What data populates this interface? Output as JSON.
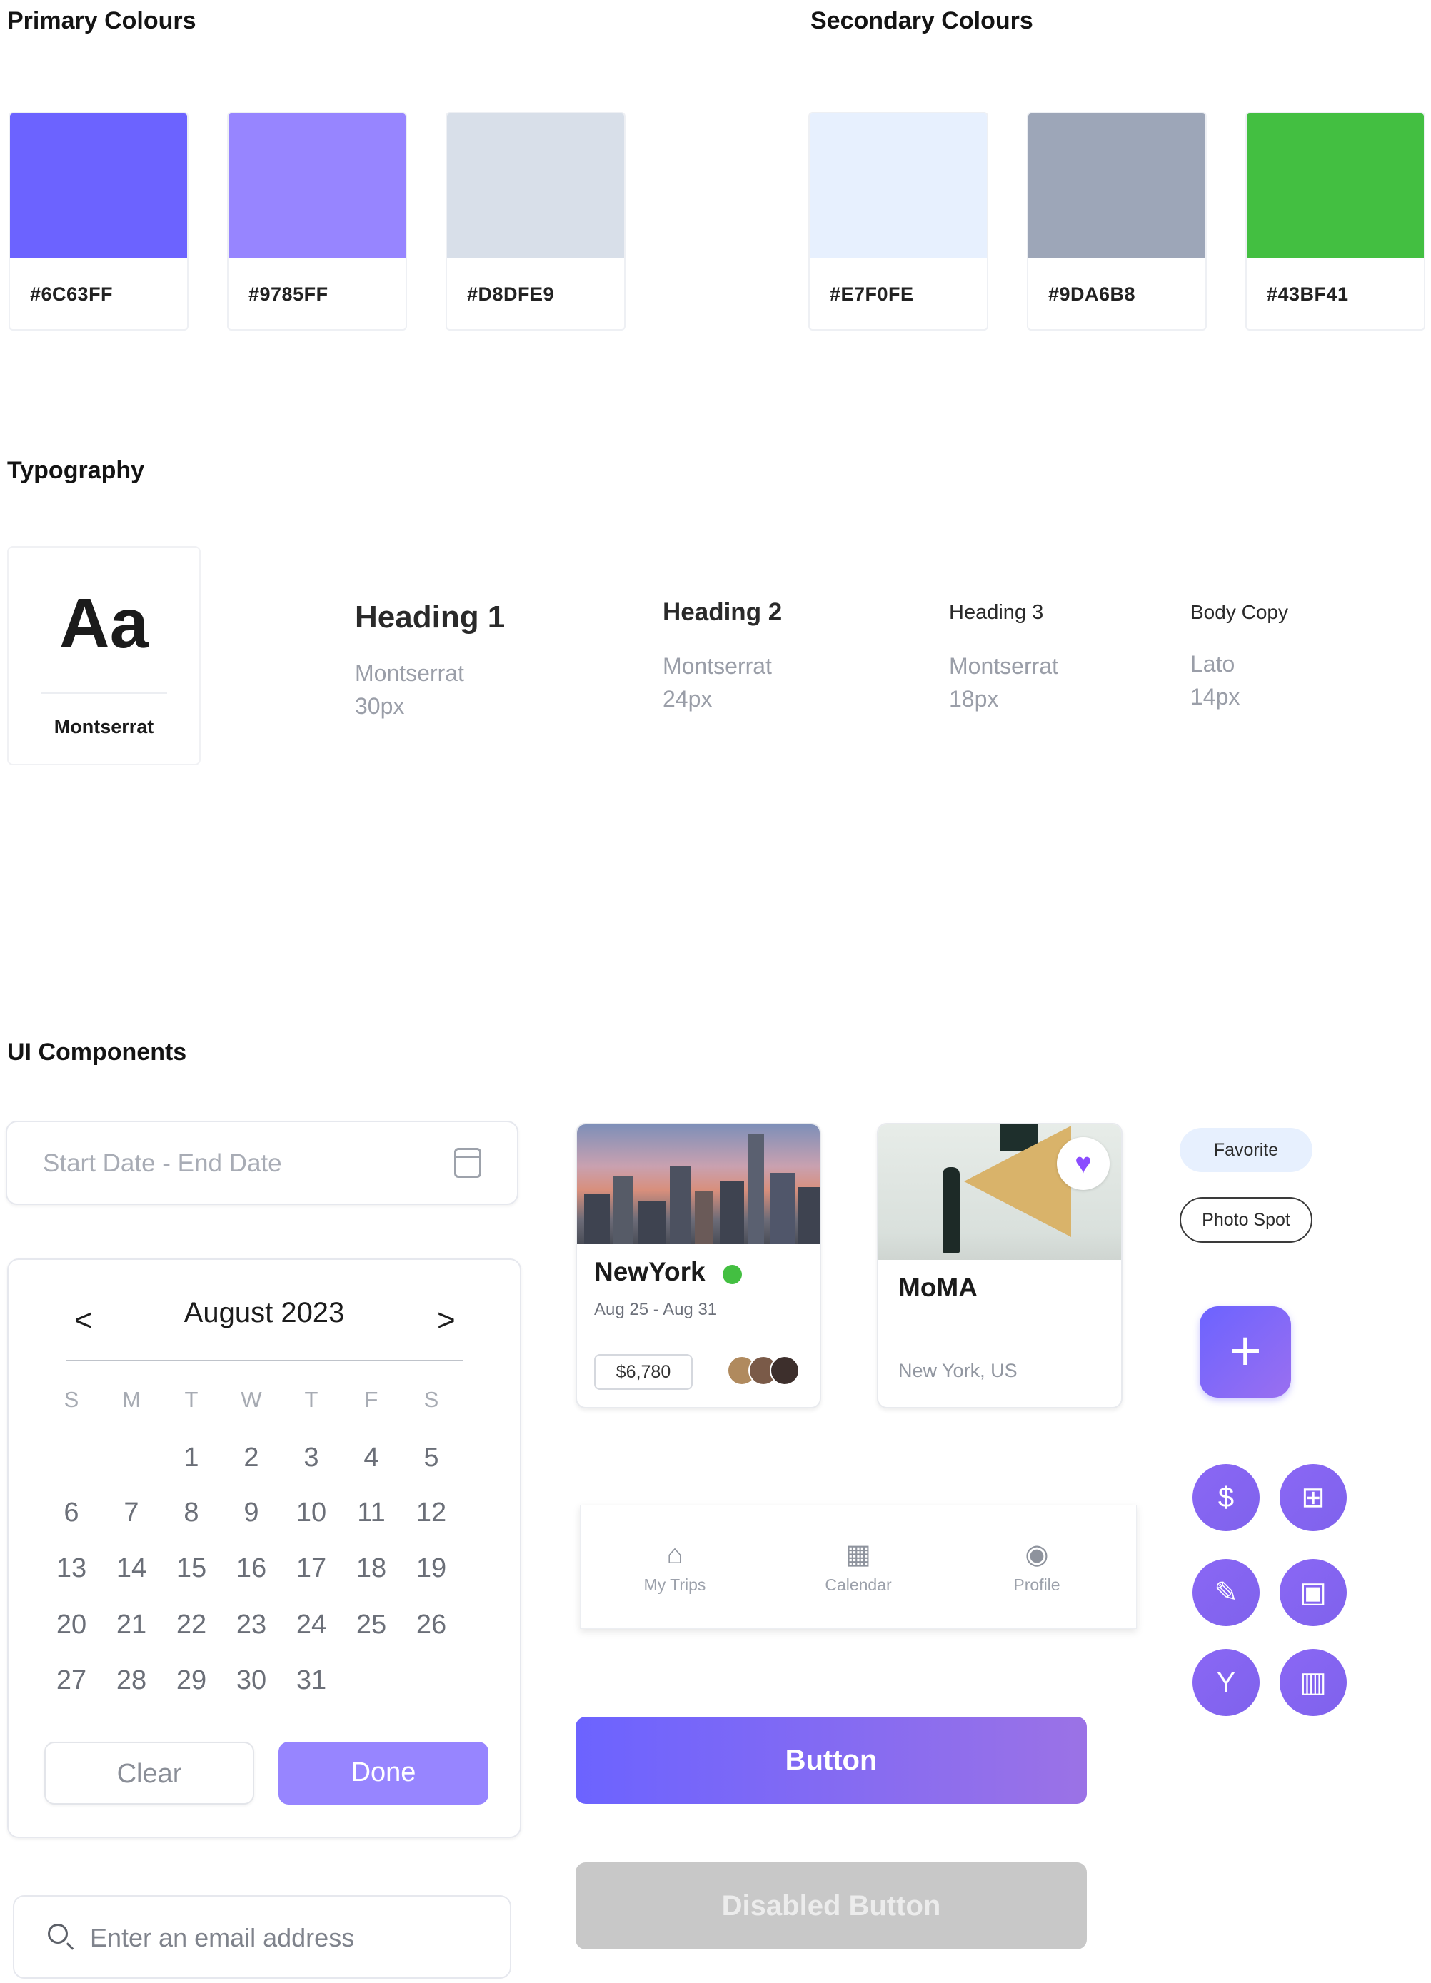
{
  "primary": {
    "title": "Primary Colours",
    "swatches": [
      {
        "hex": "#6C63FF",
        "color": "#6C63FF"
      },
      {
        "hex": "#9785FF",
        "color": "#9785FF"
      },
      {
        "hex": "#D8DFE9",
        "color": "#D8DFE9"
      }
    ]
  },
  "secondary": {
    "title": "Secondary Colours",
    "swatches": [
      {
        "hex": "#E7F0FE",
        "color": "#E7F0FE"
      },
      {
        "hex": "#9DA6B8",
        "color": "#9DA6B8"
      },
      {
        "hex": "#43BF41",
        "color": "#43BF41"
      }
    ]
  },
  "typography": {
    "title": "Typography",
    "sample": "Aa",
    "family": "Montserrat",
    "styles": [
      {
        "name": "Heading 1",
        "font": "Montserrat",
        "size": "30px"
      },
      {
        "name": "Heading 2",
        "font": "Montserrat",
        "size": "24px"
      },
      {
        "name": "Heading 3",
        "font": "Montserrat",
        "size": "18px"
      },
      {
        "name": "Body Copy",
        "font": "Lato",
        "size": "14px"
      }
    ]
  },
  "components": {
    "title": "UI Components",
    "date_input": {
      "placeholder": "Start Date - End Date",
      "icon": "calendar-icon"
    },
    "calendar": {
      "month": "August 2023",
      "prev": "<",
      "next": ">",
      "weekdays": [
        "S",
        "M",
        "T",
        "W",
        "T",
        "F",
        "S"
      ],
      "days": [
        "1",
        "2",
        "3",
        "4",
        "5",
        "6",
        "7",
        "8",
        "9",
        "10",
        "11",
        "12",
        "13",
        "14",
        "15",
        "16",
        "17",
        "18",
        "19",
        "20",
        "21",
        "22",
        "23",
        "24",
        "25",
        "26",
        "27",
        "28",
        "29",
        "30",
        "31"
      ],
      "first_weekday": 2,
      "clear": "Clear",
      "done": "Done"
    },
    "email_input": {
      "placeholder": "Enter an email address",
      "icon": "search-icon"
    },
    "trip_card": {
      "title": "NewYork",
      "dates": "Aug 25 - Aug 31",
      "price": "$6,780",
      "status_color": "#43BF41"
    },
    "place_card": {
      "title": "MoMA",
      "location": "New York, US",
      "favorite_icon": "heart-icon"
    },
    "tags": {
      "favorite": "Favorite",
      "photo_spot": "Photo Spot"
    },
    "fab": {
      "icon": "plus-icon",
      "glyph": "+"
    },
    "icon_buttons": [
      {
        "icon": "currency-exchange-icon",
        "glyph": "$"
      },
      {
        "icon": "bookmark-add-icon",
        "glyph": "⊞"
      },
      {
        "icon": "note-edit-icon",
        "glyph": "✎"
      },
      {
        "icon": "ticket-icon",
        "glyph": "▣"
      },
      {
        "icon": "route-split-icon",
        "glyph": "Y"
      },
      {
        "icon": "map-icon",
        "glyph": "▥"
      }
    ],
    "nav": [
      {
        "label": "My Trips",
        "icon": "home-icon",
        "glyph": "⌂"
      },
      {
        "label": "Calendar",
        "icon": "calendar-icon",
        "glyph": "▦"
      },
      {
        "label": "Profile",
        "icon": "profile-icon",
        "glyph": "◉"
      }
    ],
    "button": "Button",
    "disabled_button": "Disabled Button"
  }
}
